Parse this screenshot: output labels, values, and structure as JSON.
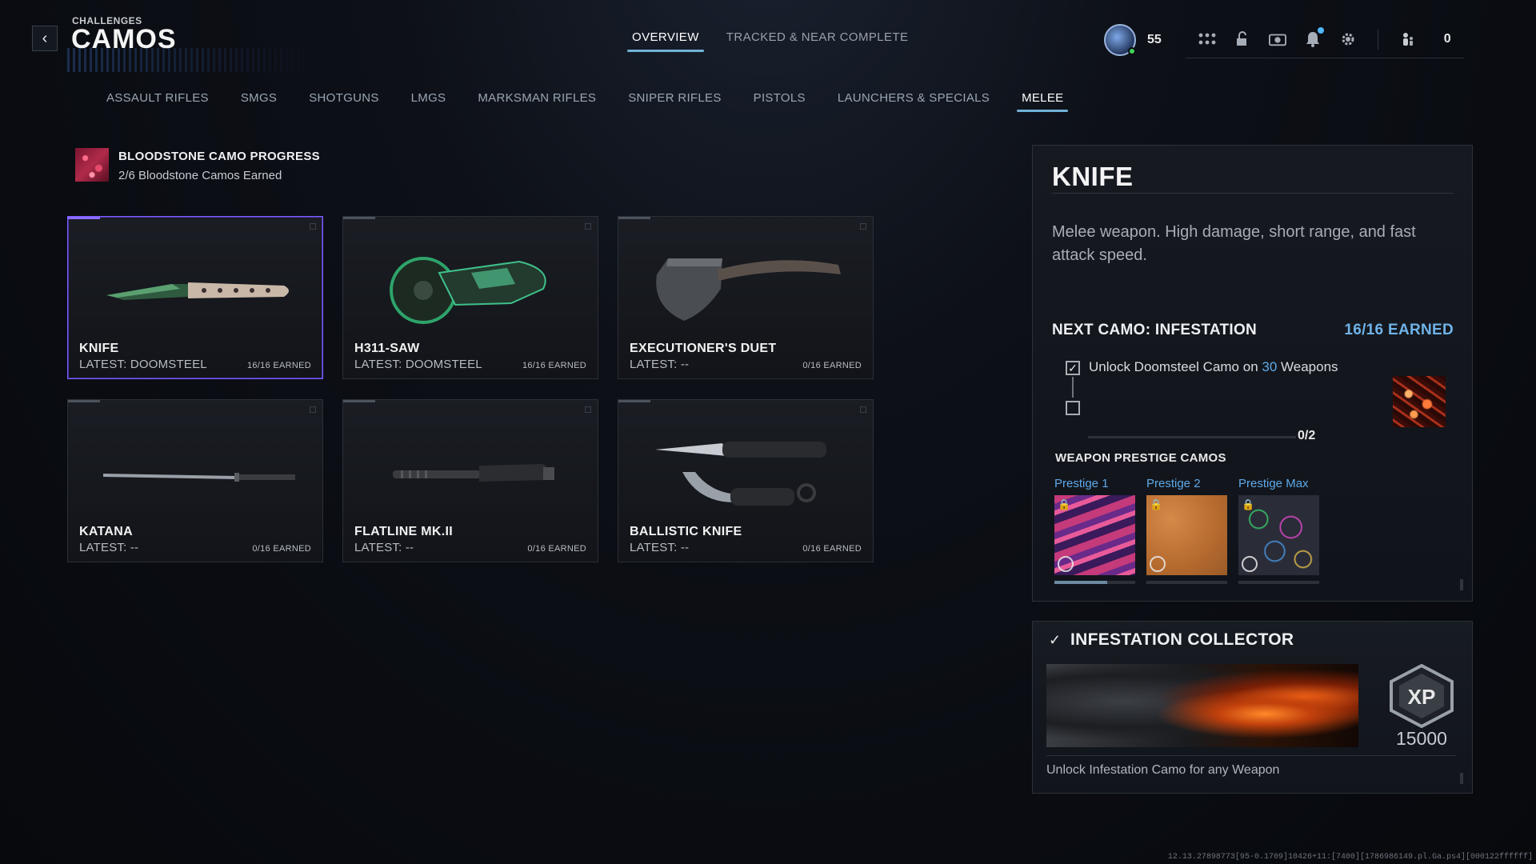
{
  "header": {
    "crumb": "CHALLENGES",
    "title": "CAMOS",
    "tabs": [
      {
        "label": "OVERVIEW",
        "active": true
      },
      {
        "label": "TRACKED & NEAR COMPLETE",
        "active": false
      }
    ],
    "level": "55",
    "party_count": "0"
  },
  "categories": [
    {
      "label": "ASSAULT RIFLES",
      "active": false
    },
    {
      "label": "SMGS",
      "active": false
    },
    {
      "label": "SHOTGUNS",
      "active": false
    },
    {
      "label": "LMGS",
      "active": false
    },
    {
      "label": "MARKSMAN RIFLES",
      "active": false
    },
    {
      "label": "SNIPER RIFLES",
      "active": false
    },
    {
      "label": "PISTOLS",
      "active": false
    },
    {
      "label": "LAUNCHERS & SPECIALS",
      "active": false
    },
    {
      "label": "MELEE",
      "active": true
    }
  ],
  "bloodstone": {
    "title": "BLOODSTONE CAMO PROGRESS",
    "subtitle": "2/6 Bloodstone Camos Earned"
  },
  "weapons": [
    {
      "name": "KNIFE",
      "latest": "LATEST: DOOMSTEEL",
      "earned": "16/16 EARNED",
      "selected": true
    },
    {
      "name": "H311-SAW",
      "latest": "LATEST: DOOMSTEEL",
      "earned": "16/16 EARNED",
      "selected": false
    },
    {
      "name": "EXECUTIONER'S DUET",
      "latest": "LATEST: --",
      "earned": "0/16 EARNED",
      "selected": false
    },
    {
      "name": "KATANA",
      "latest": "LATEST: --",
      "earned": "0/16 EARNED",
      "selected": false
    },
    {
      "name": "FLATLINE MK.II",
      "latest": "LATEST: --",
      "earned": "0/16 EARNED",
      "selected": false
    },
    {
      "name": "BALLISTIC KNIFE",
      "latest": "LATEST: --",
      "earned": "0/16 EARNED",
      "selected": false
    }
  ],
  "detail": {
    "title": "KNIFE",
    "description": "Melee weapon. High damage, short range, and fast attack speed.",
    "next_camo_label": "NEXT CAMO: INFESTATION",
    "next_camo_earned": "16/16 EARNED",
    "challenge_prefix": "Unlock Doomsteel Camo on ",
    "challenge_count": "30",
    "challenge_suffix": " Weapons",
    "challenge_progress": "0/2",
    "prestige_title": "WEAPON PRESTIGE CAMOS",
    "prestige": [
      {
        "label": "Prestige 1",
        "progress": 0.65
      },
      {
        "label": "Prestige 2",
        "progress": 0
      },
      {
        "label": "Prestige Max",
        "progress": 0
      }
    ]
  },
  "collector": {
    "title": "INFESTATION COLLECTOR",
    "xp_label": "XP",
    "xp_value": "15000",
    "description": "Unlock Infestation Camo for any Weapon"
  },
  "footer": "12.13.27898773[95-0.1709]10426+11:[7400][1786986149.pl.Ga.ps4][000122ffffff]",
  "colors": {
    "accent_blue": "#6fb3d8",
    "selected_purple": "#8a6cff",
    "earned_blue": "#6fb3e8"
  }
}
